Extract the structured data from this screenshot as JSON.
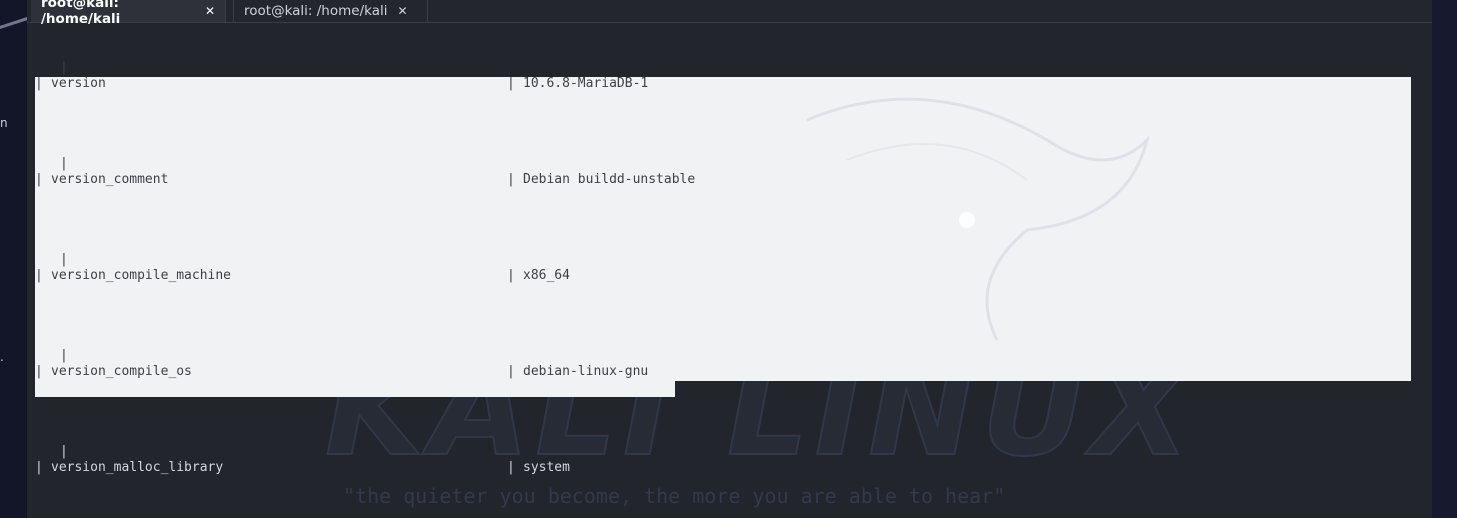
{
  "tabs": [
    {
      "label": "root@kali: /home/kali",
      "close": "✕",
      "active": true
    },
    {
      "label": "root@kali: /home/kali",
      "close": "✕",
      "active": false
    }
  ],
  "desktop_fragments": [
    "n",
    "."
  ],
  "wallpaper": {
    "brand": "KALI LINUX",
    "tagline": "\"the quieter you become, the more you are able to hear\""
  },
  "terminal": {
    "pipe": "|",
    "rows": [
      {
        "name": "version",
        "value": "10.6.8-MariaDB-1"
      },
      {
        "name": "version_comment",
        "value": "Debian buildd-unstable"
      },
      {
        "name": "version_compile_machine",
        "value": "x86_64"
      },
      {
        "name": "version_compile_os",
        "value": "debian-linux-gnu"
      },
      {
        "name": "version_malloc_library",
        "value": "system"
      }
    ]
  }
}
